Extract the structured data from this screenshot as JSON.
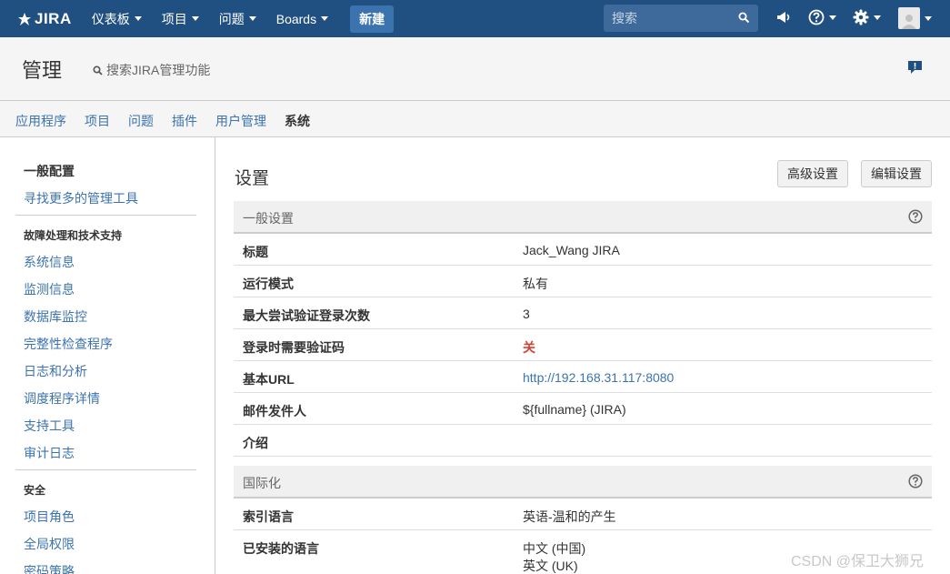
{
  "topbar": {
    "logo": "JIRA",
    "nav": [
      "仪表板",
      "项目",
      "问题",
      "Boards"
    ],
    "create": "新建",
    "search_placeholder": "搜索"
  },
  "admin": {
    "title": "管理",
    "search_label": "搜索JIRA管理功能"
  },
  "tabs": [
    "应用程序",
    "项目",
    "问题",
    "插件",
    "用户管理",
    "系统"
  ],
  "sidebar": {
    "general_config": "一般配置",
    "find_more": "寻找更多的管理工具",
    "troubleshoot_heading": "故障处理和技术支持",
    "troubleshoot_items": [
      "系统信息",
      "监测信息",
      "数据库监控",
      "完整性检查程序",
      "日志和分析",
      "调度程序详情",
      "支持工具",
      "审计日志"
    ],
    "security_heading": "安全",
    "security_items": [
      "项目角色",
      "全局权限",
      "密码策略"
    ]
  },
  "main": {
    "title": "设置",
    "advanced_btn": "高级设置",
    "edit_btn": "编辑设置",
    "general_section": "一般设置",
    "general_rows": [
      {
        "key": "标题",
        "value": "Jack_Wang JIRA"
      },
      {
        "key": "运行模式",
        "value": "私有"
      },
      {
        "key": "最大尝试验证登录次数",
        "value": "3"
      },
      {
        "key": "登录时需要验证码",
        "value": "关"
      },
      {
        "key": "基本URL",
        "value": "http://192.168.31.117:8080"
      },
      {
        "key": "邮件发件人",
        "value": "${fullname} (JIRA)"
      },
      {
        "key": "介绍",
        "value": ""
      }
    ],
    "i18n_section": "国际化",
    "i18n_rows": [
      {
        "key": "索引语言",
        "value": "英语-温和的产生"
      },
      {
        "key": "已安装的语言",
        "value": "中文 (中国)",
        "value2": "英文 (UK)"
      }
    ]
  },
  "watermark": "CSDN @保卫大狮兄"
}
